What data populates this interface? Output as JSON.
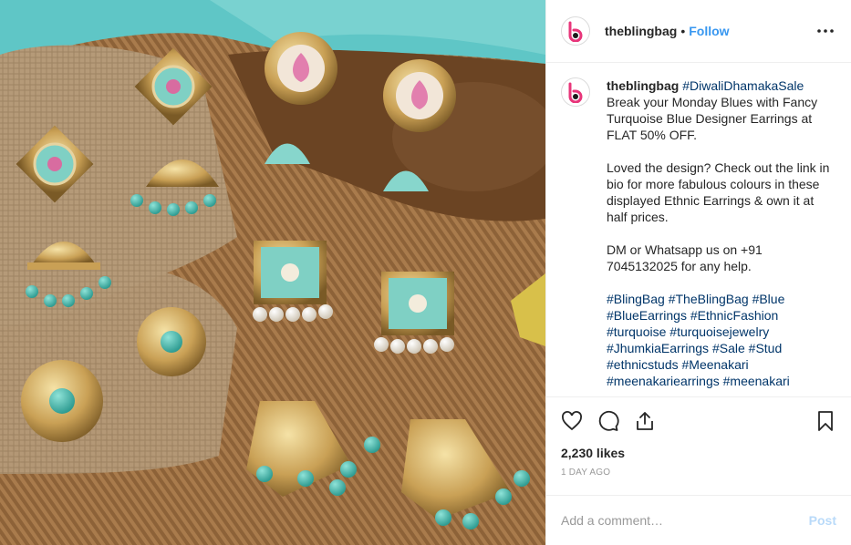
{
  "header": {
    "username": "theblingbag",
    "separator": "•",
    "follow_label": "Follow",
    "more_icon": "more-horizontal-icon"
  },
  "caption": {
    "username": "theblingbag",
    "hashtag_lead": "#DiwaliDhamakaSale",
    "line1": "Break your Monday Blues with Fancy Turquoise Blue Designer Earrings at FLAT 50% OFF.",
    "para2": "Loved the design? Check out the link in bio for more fabulous colours in these displayed Ethnic Earrings & own it at half prices.",
    "para3": "DM or Whatsapp us on +91 7045132025 for any help.",
    "hashtags": [
      "#BlingBag",
      "#TheBlingBag",
      "#Blue",
      "#BlueEarrings",
      "#EthnicFashion",
      "#turquoise",
      "#turquoisejewelry",
      "#JhumkiaEarrings",
      "#Sale",
      "#Stud",
      "#ethnicstuds",
      "#Meenakari",
      "#meenakariearrings",
      "#meenakari"
    ]
  },
  "actions": {
    "like_icon": "heart-icon",
    "comment_icon": "comment-icon",
    "share_icon": "share-icon",
    "save_icon": "bookmark-icon"
  },
  "likes": "2,230 likes",
  "timestamp": "1 DAY AGO",
  "comment": {
    "placeholder": "Add a comment…",
    "post_label": "Post"
  },
  "colors": {
    "link_blue": "#3897f0",
    "hashtag_blue": "#003569",
    "logo_pink": "#e8357a"
  }
}
